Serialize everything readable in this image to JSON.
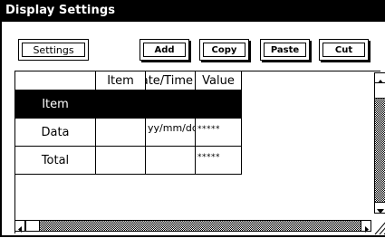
{
  "window": {
    "title": "Display Settings"
  },
  "toolbar": {
    "settings_label": "Settings",
    "add_label": "Add",
    "copy_label": "Copy",
    "paste_label": "Paste",
    "cut_label": "Cut"
  },
  "table": {
    "headers": [
      "",
      "Item",
      "Date/Time",
      "Value"
    ],
    "rows": [
      {
        "label": "Item",
        "item": "",
        "datetime": "",
        "value": ""
      },
      {
        "label": "Data",
        "item": "",
        "datetime": "yy/mm/dd",
        "value": "*****"
      },
      {
        "label": "Total",
        "item": "",
        "datetime": "",
        "value": "*****"
      }
    ]
  }
}
